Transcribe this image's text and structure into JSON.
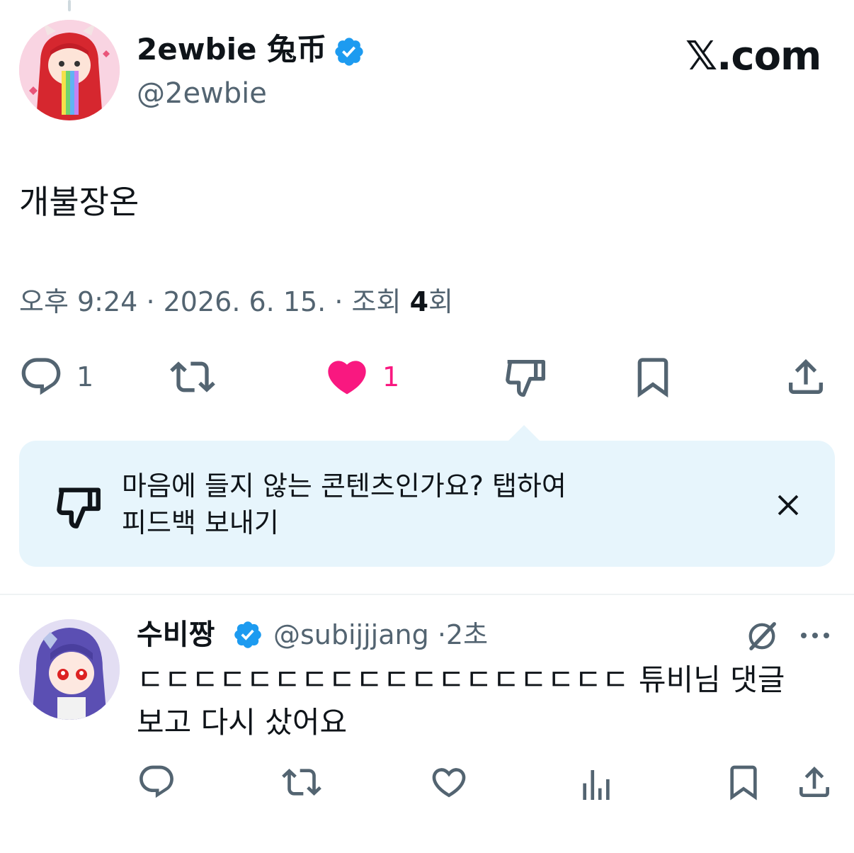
{
  "post": {
    "display_name": "2ewbie 兔币",
    "handle": "@2ewbie",
    "brand": "𝕏.com",
    "text": "개불장온",
    "time": "오후 9:24",
    "sep": "·",
    "date": "2026. 6. 15.",
    "views_label": "조회",
    "views_count": "4",
    "views_suffix": "회",
    "reply_count": "1",
    "like_count": "1"
  },
  "tooltip": {
    "line1": "마음에 들지 않는 콘텐츠인가요? 탭하여",
    "line2": "피드백 보내기"
  },
  "reply": {
    "display_name": "수비짱",
    "handle": "@subijjjang",
    "sep": "·",
    "time": "2초",
    "line1": "ㄷㄷㄷㄷㄷㄷㄷㄷㄷㄷㄷㄷㄷㄷㄷㄷㄷㄷ 튜비님 댓글",
    "line2": "보고 다시 샀어요"
  },
  "colors": {
    "text": "#0f1419",
    "secondary": "#536471",
    "verified": "#1d9bf0",
    "like": "#f91880",
    "tooltip_bg": "#e7f5fc"
  },
  "icons": [
    "reply-icon",
    "retweet-icon",
    "heart-icon",
    "dislike-icon",
    "bookmark-icon",
    "share-icon",
    "close-icon",
    "grok-icon",
    "more-icon",
    "analytics-icon",
    "verified-badge-icon"
  ]
}
